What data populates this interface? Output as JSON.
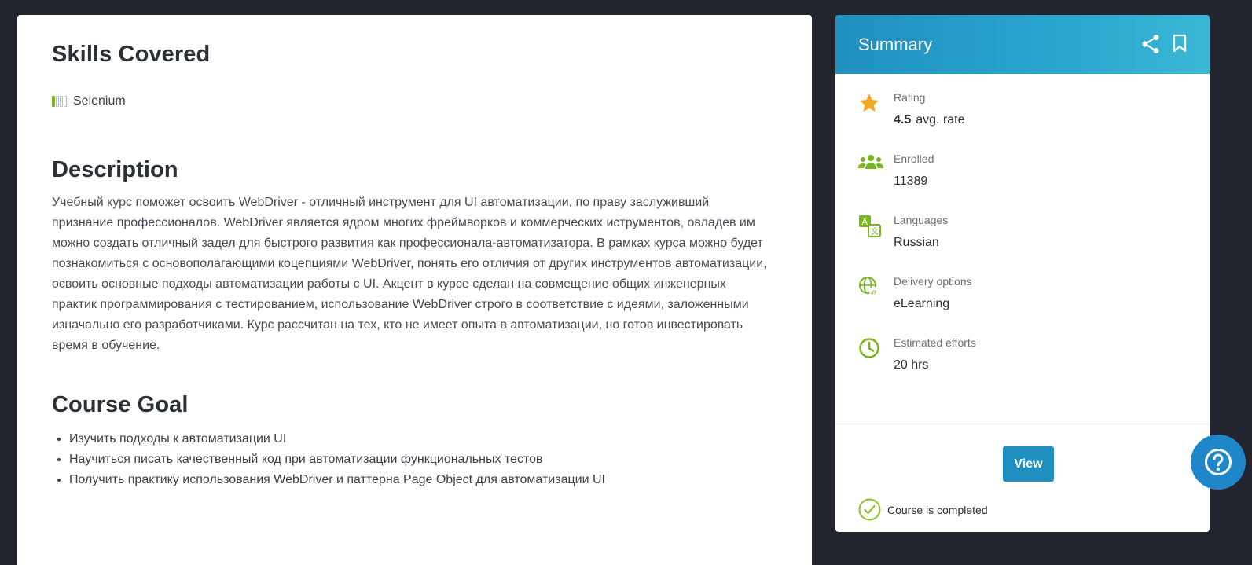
{
  "main": {
    "skills_title": "Skills Covered",
    "skill": "Selenium",
    "description_title": "Description",
    "description": "Учебный курс поможет освоить WebDriver - отличный инструмент для UI автоматизации, по праву заслуживший признание профессионалов. WebDriver является ядром многих фреймворков и коммерческих иструментов, овладев им можно создать отличный задел для быстрого развития как профессионала-автоматизатора. В рамках курса можно будет познакомиться с основополагающими коцепциями WebDriver, понять его отличия от других инструментов автоматизации, освоить основные подходы автоматизации работы с UI. Акцент в курсе сделан на совмещение общих инженерных практик программирования с тестированием, использование WebDriver строго в соответствие с идеями, заложенными изначально его разработчиками. Курс рассчитан на тех, кто не имеет опыта в автоматизации, но готов инвестировать время в обучение.",
    "goal_title": "Course Goal",
    "goals": [
      "Изучить подходы к автоматизации UI",
      "Научиться писать качественный код при автоматизации функциональных тестов",
      "Получить практику использования WebDriver и паттерна Page Object для автоматизации UI"
    ]
  },
  "summary": {
    "title": "Summary",
    "rating_label": "Rating",
    "rating_value": "4.5",
    "rating_suffix": "avg. rate",
    "enrolled_label": "Enrolled",
    "enrolled_value": "11389",
    "languages_label": "Languages",
    "languages_value": "Russian",
    "delivery_label": "Delivery options",
    "delivery_value": "eLearning",
    "efforts_label": "Estimated efforts",
    "efforts_value": "20 hrs",
    "view_label": "View",
    "completed_text": "Course is completed"
  },
  "colors": {
    "accent": "#1f8fc0",
    "green": "#7ab51d",
    "star": "#f5a623",
    "background": "#22252e"
  }
}
